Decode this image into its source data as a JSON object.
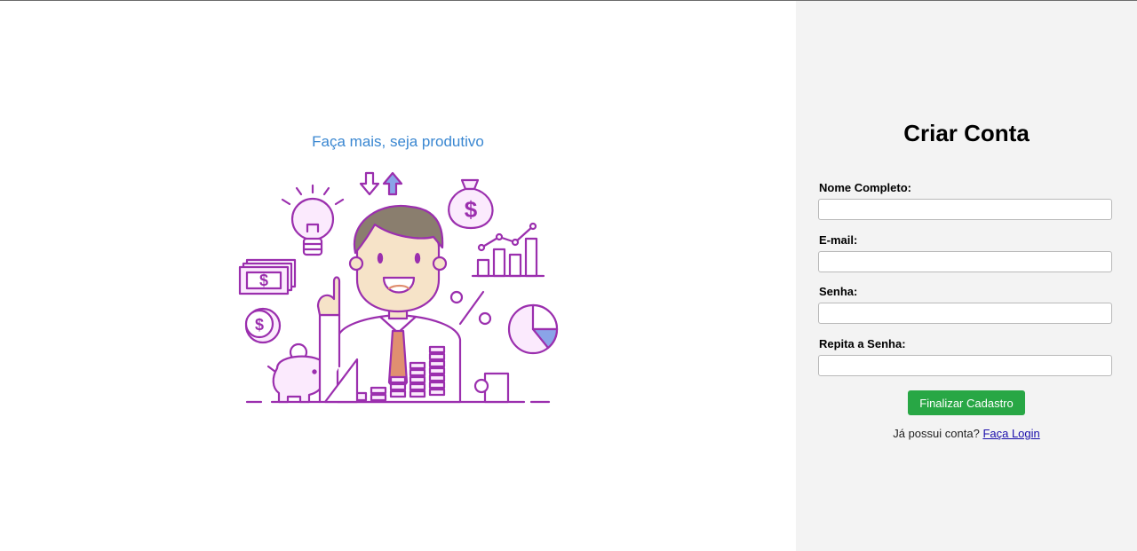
{
  "hero": {
    "tagline": "Faça mais, seja produtivo"
  },
  "form": {
    "title": "Criar Conta",
    "fields": [
      {
        "label": "Nome Completo:",
        "value": "",
        "placeholder": ""
      },
      {
        "label": "E-mail:",
        "value": "",
        "placeholder": ""
      },
      {
        "label": "Senha:",
        "value": "",
        "placeholder": ""
      },
      {
        "label": "Repita a Senha:",
        "value": "",
        "placeholder": ""
      }
    ],
    "submit_label": "Finalizar Cadastro",
    "login_prompt": "Já possui conta?",
    "login_link": "Faça Login"
  },
  "colors": {
    "accent_green": "#28a745",
    "tagline_blue": "#3a87d1",
    "illustration_purple": "#9b2fae",
    "panel_gray": "#f3f3f3"
  }
}
